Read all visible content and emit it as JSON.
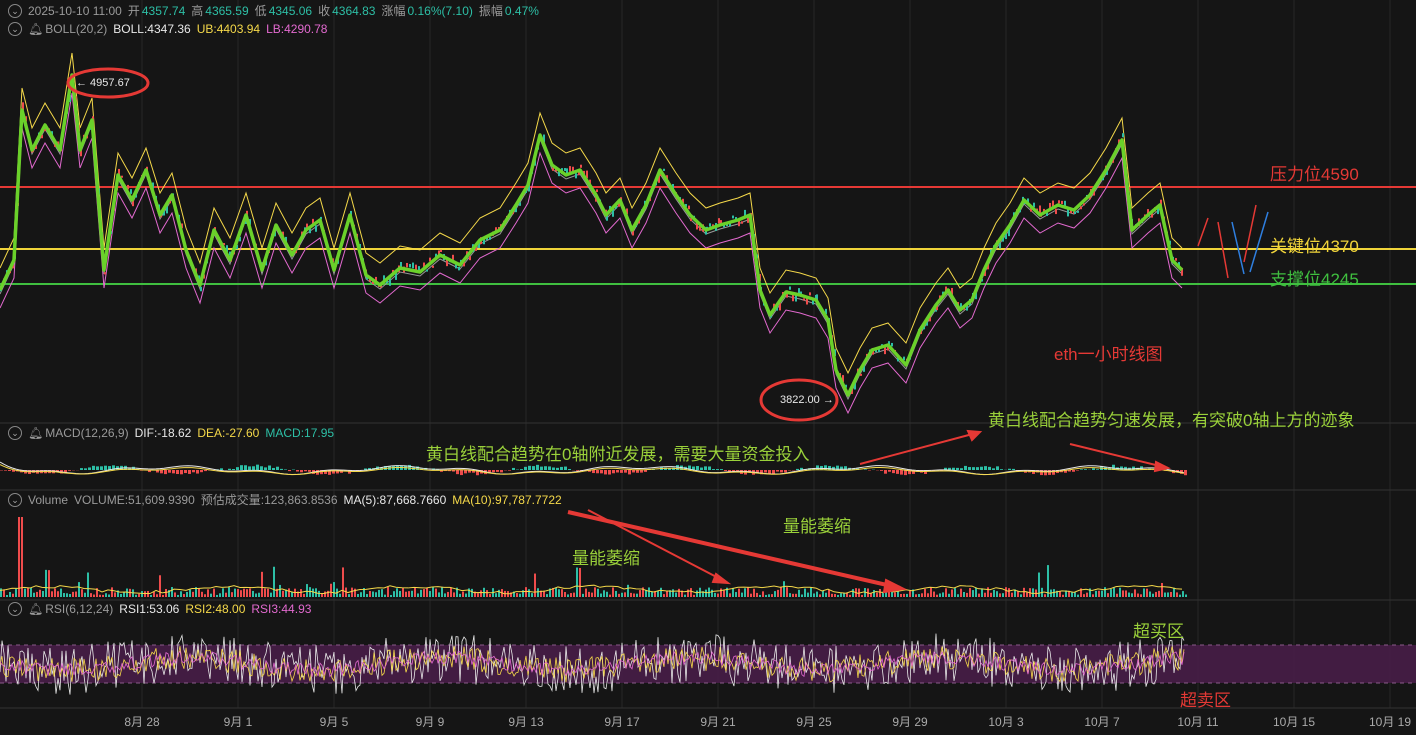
{
  "header": {
    "datetime": "2025-10-10 11:00",
    "open_label": "开",
    "open": "4357.74",
    "high_label": "高",
    "high": "4365.59",
    "low_label": "低",
    "low": "4345.06",
    "close_label": "收",
    "close": "4364.83",
    "change_label": "涨幅",
    "change": "0.16%(7.10)",
    "amplitude_label": "振幅",
    "amplitude": "0.47%"
  },
  "boll": {
    "name": "BOLL(20,2)",
    "mid": "BOLL:4347.36",
    "ub": "UB:4403.94",
    "lb": "LB:4290.78"
  },
  "macd": {
    "name": "MACD(12,26,9)",
    "dif": "DIF:-18.62",
    "dea": "DEA:-27.60",
    "macd": "MACD:17.95"
  },
  "volume": {
    "name": "Volume",
    "volume": "VOLUME:51,609.9390",
    "est": "预估成交量:123,863.8536",
    "ma5": "MA(5):87,668.7660",
    "ma10": "MA(10):97,787.7722"
  },
  "rsi": {
    "name": "RSI(6,12,24)",
    "rsi1": "RSI1:53.06",
    "rsi2": "RSI2:48.00",
    "rsi3": "RSI3:44.93"
  },
  "price_tags": {
    "high": "← 4957.67",
    "low": "3822.00 →"
  },
  "levels": {
    "resistance": "压力位4590",
    "key": "关键位4370",
    "support": "支撑位4245"
  },
  "annotations": {
    "chart_title": "eth一小时线图",
    "macd_note_1": "黄白线配合趋势在0轴附近发展，需要大量资金投入",
    "macd_note_2": "黄白线配合趋势匀速发展，有突破0轴上方的迹象",
    "vol_note_1": "量能萎缩",
    "vol_note_2": "量能萎缩",
    "overbought": "超买区",
    "oversold": "超卖区"
  },
  "x_axis": [
    "8月 28",
    "9月 1",
    "9月 5",
    "9月 9",
    "9月 13",
    "9月 17",
    "9月 21",
    "9月 25",
    "9月 29",
    "10月 3",
    "10月 7",
    "10月 11",
    "10月 15",
    "10月 19"
  ],
  "colors": {
    "up": "#2dbfa6",
    "down": "#ef4c4c",
    "price_line": "#6ad12a",
    "ub": "#f5d94a",
    "mid": "#e8e8e8",
    "lb": "#e36ad0",
    "resistance": "#e53935",
    "key": "#f0d43a",
    "support": "#3fbf3f"
  },
  "icons": [
    "collapse-chevron-icon",
    "alarm-bell-icon"
  ]
}
